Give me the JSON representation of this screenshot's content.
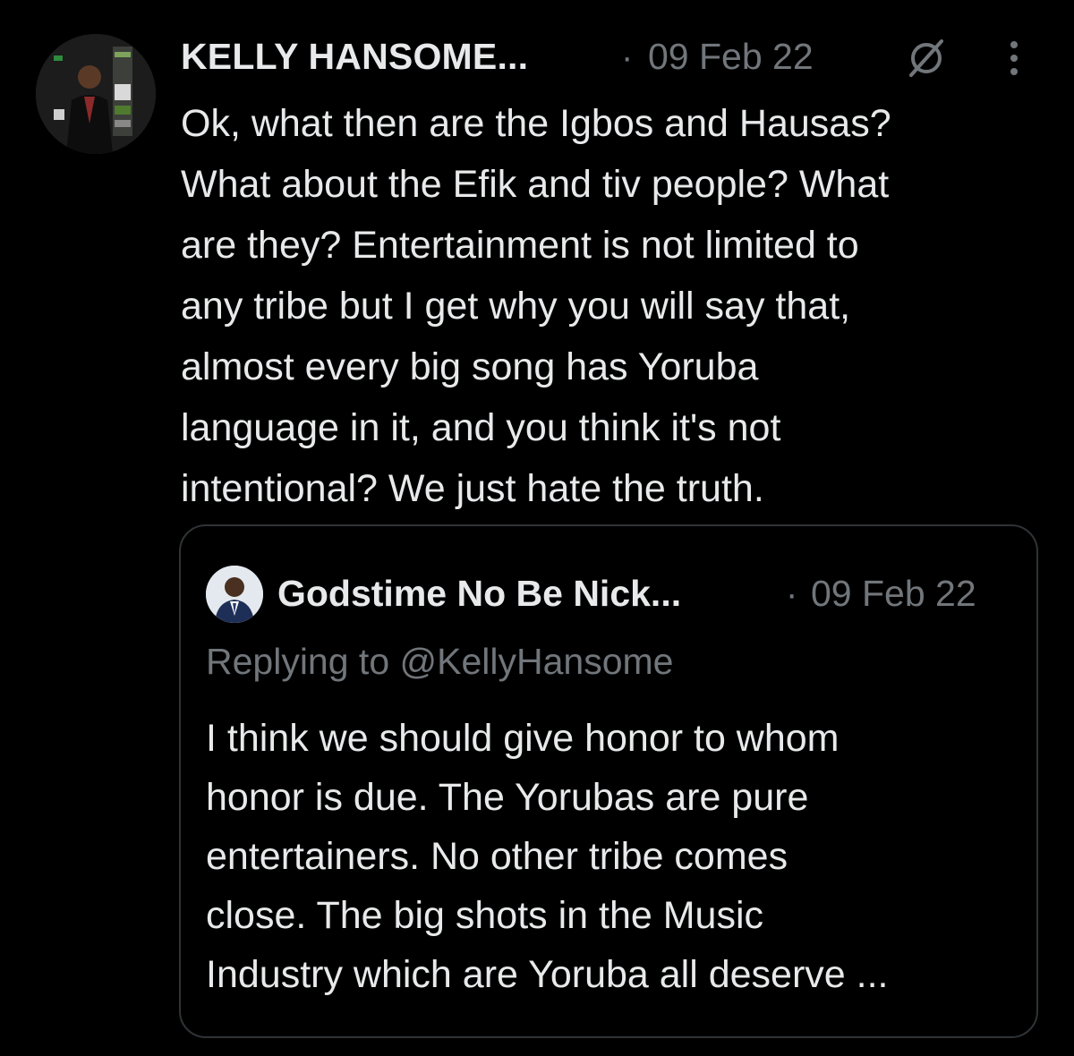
{
  "tweet": {
    "author_name": "KELLY HANSOME...",
    "separator": "·",
    "date": "09 Feb 22",
    "grok_icon": "grok-icon",
    "more_icon": "more-vertical-icon",
    "text": "Ok, what then are the Igbos and Hausas?\nWhat about the Efik and tiv people? What\nare they? Entertainment is not limited to\nany tribe but I get why you will say that,\nalmost every big song has Yoruba\nlanguage in it, and you think it's not\nintentional? We just hate the truth."
  },
  "quoted_tweet": {
    "author_name": "Godstime No Be Nick...",
    "separator": "·",
    "date": "09 Feb 22",
    "replying_to": "Replying to @KellyHansome",
    "text": "I think we should give honor to whom\nhonor is due. The Yorubas are pure\nentertainers. No other tribe comes\nclose. The big shots in the Music\nIndustry which are Yoruba all deserve ..."
  },
  "colors": {
    "background": "#000000",
    "primary_text": "#e7e9ea",
    "secondary_text": "#71767b",
    "border": "#2f3336"
  }
}
